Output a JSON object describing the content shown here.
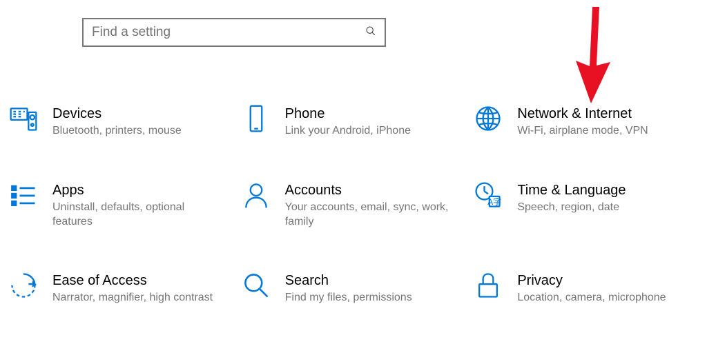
{
  "search": {
    "placeholder": "Find a setting"
  },
  "tiles": [
    {
      "title": "Devices",
      "subtitle": "Bluetooth, printers, mouse"
    },
    {
      "title": "Phone",
      "subtitle": "Link your Android, iPhone"
    },
    {
      "title": "Network & Internet",
      "subtitle": "Wi-Fi, airplane mode, VPN"
    },
    {
      "title": "Apps",
      "subtitle": "Uninstall, defaults, optional features"
    },
    {
      "title": "Accounts",
      "subtitle": "Your accounts, email, sync, work, family"
    },
    {
      "title": "Time & Language",
      "subtitle": "Speech, region, date"
    },
    {
      "title": "Ease of Access",
      "subtitle": "Narrator, magnifier, high contrast"
    },
    {
      "title": "Search",
      "subtitle": "Find my files, permissions"
    },
    {
      "title": "Privacy",
      "subtitle": "Location, camera, microphone"
    }
  ]
}
